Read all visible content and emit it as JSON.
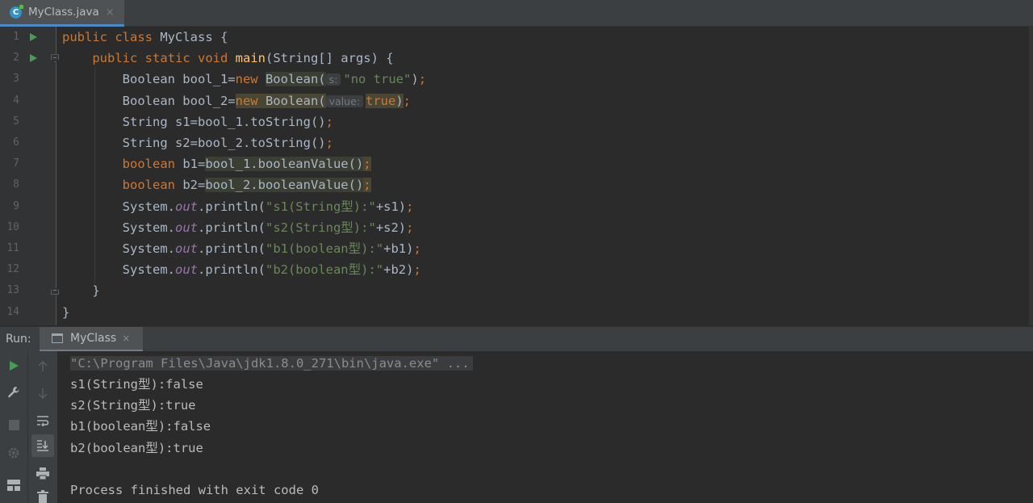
{
  "editor_tab": {
    "icon": "java-class-icon",
    "filename": "MyClass.java",
    "close": "×"
  },
  "code_lines": [
    {
      "n": "1",
      "parts": [
        [
          "kw",
          "public "
        ],
        [
          "kw",
          "class "
        ],
        [
          "",
          "MyClass {"
        ]
      ]
    },
    {
      "n": "2",
      "parts": [
        [
          "",
          "    "
        ],
        [
          "kw",
          "public "
        ],
        [
          "kw",
          "static "
        ],
        [
          "kw",
          "void "
        ],
        [
          "fn",
          "main"
        ],
        [
          "",
          "(String[] args) {"
        ]
      ]
    },
    {
      "n": "3",
      "parts": [
        [
          "",
          "        Boolean bool_1="
        ],
        [
          "kw",
          "new "
        ],
        [
          "hl",
          "Boolean("
        ],
        [
          "hint",
          "s:"
        ],
        [
          "str",
          "\"no true\""
        ],
        [
          "",
          ")"
        ],
        [
          "kw",
          ";"
        ]
      ]
    },
    {
      "n": "4",
      "parts": [
        [
          "",
          "        Boolean bool_2="
        ],
        [
          "kwhl",
          "new "
        ],
        [
          "hl2",
          "Boolean("
        ],
        [
          "hint2",
          "value:"
        ],
        [
          "kwhl",
          "true"
        ],
        [
          "hl2",
          ")"
        ],
        [
          "kw",
          ";"
        ]
      ]
    },
    {
      "n": "5",
      "parts": [
        [
          "",
          "        String s1=bool_1.toString()"
        ],
        [
          "kw",
          ";"
        ]
      ]
    },
    {
      "n": "6",
      "parts": [
        [
          "",
          "        String s2=bool_2.toString()"
        ],
        [
          "kw",
          ";"
        ]
      ]
    },
    {
      "n": "7",
      "parts": [
        [
          "",
          "        "
        ],
        [
          "kw",
          "boolean "
        ],
        [
          "",
          "b1="
        ],
        [
          "hl",
          "bool_1.booleanValue()"
        ],
        [
          "kwhl",
          ";"
        ]
      ]
    },
    {
      "n": "8",
      "parts": [
        [
          "",
          "        "
        ],
        [
          "kw",
          "boolean "
        ],
        [
          "",
          "b2="
        ],
        [
          "hl",
          "bool_2.booleanValue()"
        ],
        [
          "kwhl",
          ";"
        ]
      ]
    },
    {
      "n": "9",
      "parts": [
        [
          "",
          "        System."
        ],
        [
          "fld",
          "out"
        ],
        [
          "",
          ".println("
        ],
        [
          "str",
          "\"s1(String型):\""
        ],
        [
          "",
          "+s1)"
        ],
        [
          "kw",
          ";"
        ]
      ]
    },
    {
      "n": "10",
      "parts": [
        [
          "",
          "        System."
        ],
        [
          "fld",
          "out"
        ],
        [
          "",
          ".println("
        ],
        [
          "str",
          "\"s2(String型):\""
        ],
        [
          "",
          "+s2)"
        ],
        [
          "kw",
          ";"
        ]
      ]
    },
    {
      "n": "11",
      "parts": [
        [
          "",
          "        System."
        ],
        [
          "fld",
          "out"
        ],
        [
          "",
          ".println("
        ],
        [
          "str",
          "\"b1(boolean型):\""
        ],
        [
          "",
          "+b1)"
        ],
        [
          "kw",
          ";"
        ]
      ]
    },
    {
      "n": "12",
      "parts": [
        [
          "",
          "        System."
        ],
        [
          "fld",
          "out"
        ],
        [
          "",
          ".println("
        ],
        [
          "str",
          "\"b2(boolean型):\""
        ],
        [
          "",
          "+b2)"
        ],
        [
          "kw",
          ";"
        ]
      ]
    },
    {
      "n": "13",
      "parts": [
        [
          "",
          "    }"
        ]
      ]
    },
    {
      "n": "14",
      "parts": [
        [
          "",
          "}"
        ]
      ]
    }
  ],
  "gutter_markers": {
    "run_lines": [
      "1",
      "2"
    ],
    "fold_open": [
      "2"
    ],
    "fold_close": [
      "13"
    ]
  },
  "run_window": {
    "label": "Run:",
    "tab_name": "MyClass",
    "tab_close": "×",
    "console": {
      "command": "\"C:\\Program Files\\Java\\jdk1.8.0_271\\bin\\java.exe\" ...",
      "output": [
        "s1(String型):false",
        "s2(String型):true",
        "b1(boolean型):false",
        "b2(boolean型):true"
      ],
      "blank": "",
      "exit": "Process finished with exit code 0"
    }
  },
  "toolbar_left": [
    "run-icon",
    "wrench-icon",
    "stop-icon",
    "settings-icon",
    "layout-icon"
  ],
  "toolbar_right": [
    "scroll-up-icon",
    "scroll-down-icon",
    "soft-wrap-icon",
    "scroll-to-end-icon",
    "print-icon",
    "trash-icon"
  ],
  "colors": {
    "keyword": "#cc7832",
    "string": "#6a8759",
    "method": "#ffc66d",
    "field": "#9876aa",
    "text": "#a9b7c6",
    "background": "#2b2b2b"
  }
}
